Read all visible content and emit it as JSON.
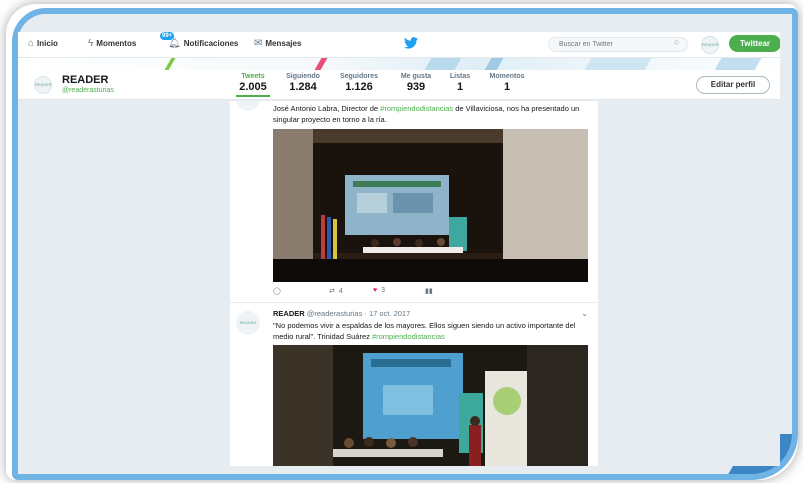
{
  "nav": {
    "home": "Inicio",
    "moments": "Momentos",
    "notifications": "Notificaciones",
    "notifications_badge": "99+",
    "messages": "Mensajes",
    "search_placeholder": "Buscar en Twitter",
    "tweet_button": "Twittear",
    "avatar_text": "READER"
  },
  "profile": {
    "name": "READER",
    "handle": "@readerasturias",
    "avatar_text": "READER",
    "edit_button": "Editar perfil",
    "stats": [
      {
        "label": "Tweets",
        "value": "2.005"
      },
      {
        "label": "Siguiendo",
        "value": "1.284"
      },
      {
        "label": "Seguidores",
        "value": "1.126"
      },
      {
        "label": "Me gusta",
        "value": "939"
      },
      {
        "label": "Listas",
        "value": "1"
      },
      {
        "label": "Momentos",
        "value": "1"
      }
    ]
  },
  "tweets": [
    {
      "text_before": "José Antonio Labra, Director de ",
      "hashtag": "#rompiendodistancias",
      "text_after": " de Villaviciosa, nos ha presentado un singular proyecto en torno a la ría.",
      "replies": "",
      "retweets": "4",
      "likes": "3"
    },
    {
      "author": "READER",
      "handle_date": "@readerasturias · 17 oct. 2017",
      "text": "\"No podemos vivir a espaldas de los mayores. Ellos siguen siendo un activo importante del medio rural\". Trinidad Suárez ",
      "hashtag": "#rompiendodistancias",
      "avatar_text": "READER"
    }
  ],
  "colors": {
    "accent": "#4cae4c",
    "frame": "#6fb4e4",
    "twitter_blue": "#1da1f2",
    "like": "#e0245e"
  }
}
